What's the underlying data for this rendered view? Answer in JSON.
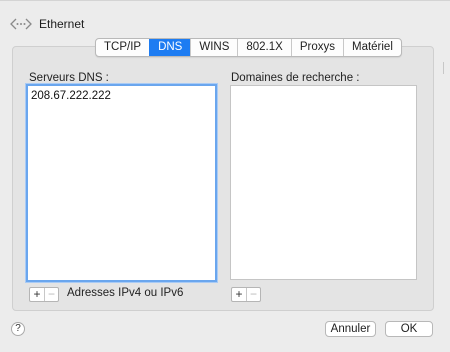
{
  "header": {
    "title": "Ethernet",
    "icon": "ethernet-arrows-icon"
  },
  "tabs": [
    {
      "label": "TCP/IP",
      "active": false
    },
    {
      "label": "DNS",
      "active": true
    },
    {
      "label": "WINS",
      "active": false
    },
    {
      "label": "802.1X",
      "active": false
    },
    {
      "label": "Proxys",
      "active": false
    },
    {
      "label": "Matériel",
      "active": false
    }
  ],
  "dns": {
    "label": "Serveurs DNS :",
    "entries": [
      "208.67.222.222"
    ],
    "add_label": "+",
    "remove_label": "−",
    "hint": "Adresses IPv4 ou IPv6"
  },
  "search": {
    "label": "Domaines de recherche :",
    "add_label": "+",
    "remove_label": "−"
  },
  "footer": {
    "help_label": "?",
    "cancel_label": "Annuler",
    "ok_label": "OK"
  },
  "colors": {
    "accent": "#1d7cf2",
    "focus_ring": "#6aa6ee"
  }
}
